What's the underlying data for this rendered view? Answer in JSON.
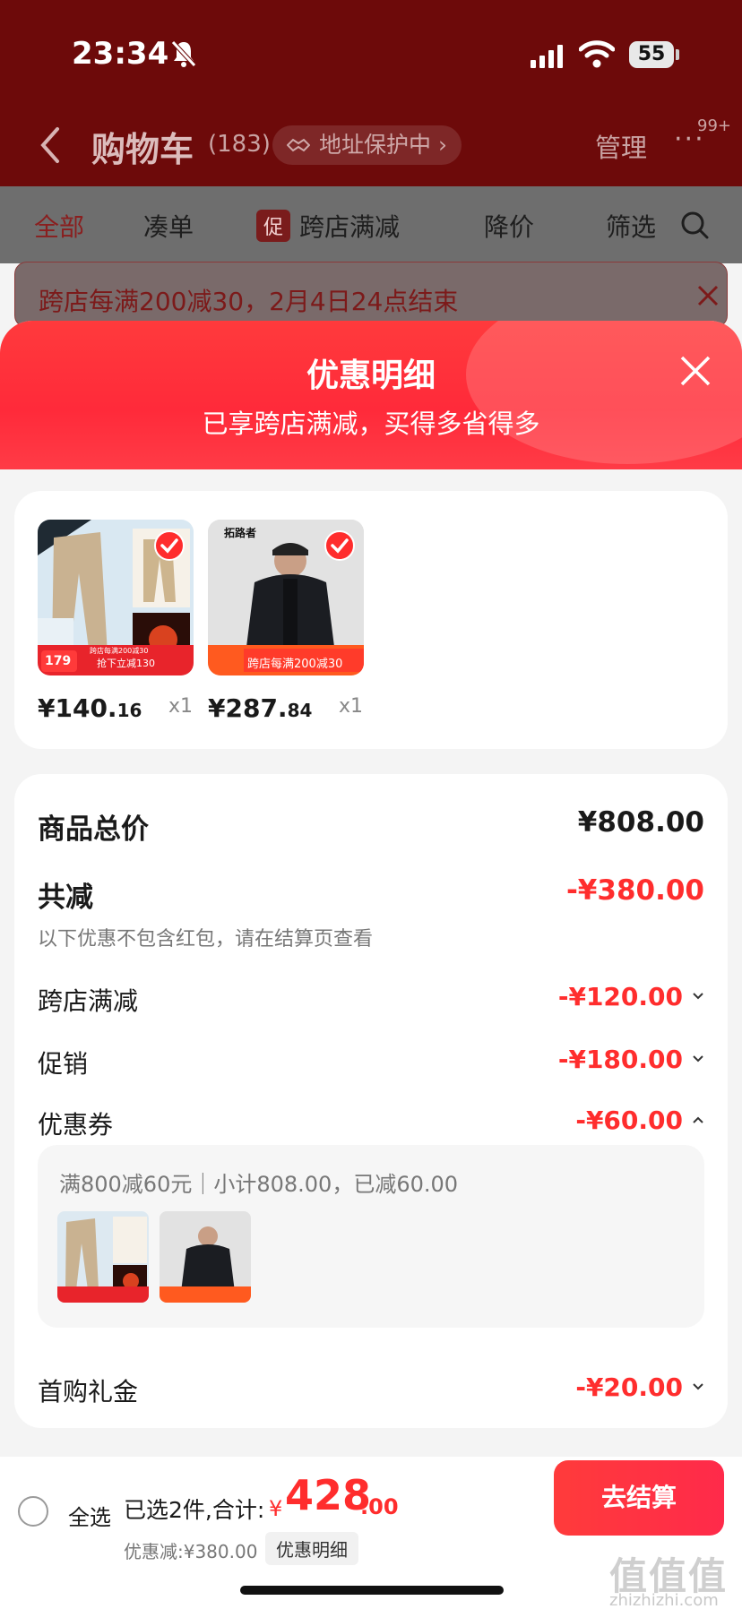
{
  "status_bar": {
    "time": "23:34",
    "battery": "55"
  },
  "nav": {
    "title": "购物车",
    "count": "(183)",
    "address_pill": "地址保护中",
    "manage": "管理",
    "more": "···",
    "badge": "99+"
  },
  "tabs": [
    {
      "label": "全部"
    },
    {
      "label": "凑单"
    },
    {
      "label": "跨店满减",
      "tag": "促"
    },
    {
      "label": "降价"
    },
    {
      "label": "筛选"
    }
  ],
  "promo_banner": {
    "text": "跨店每满200减30，2月4日24点结束"
  },
  "sheet": {
    "title": "优惠明细",
    "subtitle": "已享跨店满减，买得多省得多"
  },
  "products": [
    {
      "price_int": "¥140.",
      "price_dec": "16",
      "qty": "x1",
      "badge_price": "179",
      "badge_text": "抢下立减130",
      "badge_top": "跨店每满200减30"
    },
    {
      "price_int": "¥287.",
      "price_dec": "84",
      "qty": "x1",
      "badge_text": "跨店每满200减30",
      "brand": "拓路者"
    }
  ],
  "summary": {
    "total_label": "商品总价",
    "total_value": "¥808.00",
    "reduce_label": "共减",
    "reduce_value": "-¥380.00",
    "reduce_note": "以下优惠不包含红包，请在结算页查看",
    "rows": [
      {
        "label": "跨店满减",
        "value": "-¥120.00"
      },
      {
        "label": "促销",
        "value": "-¥180.00"
      },
      {
        "label": "优惠券",
        "value": "-¥60.00"
      },
      {
        "label": "首购礼金",
        "value": "-¥20.00"
      }
    ],
    "coupon_text": "满800减60元｜小计808.00，已减60.00"
  },
  "bottom": {
    "select_all": "全选",
    "selected": "已选2件,合计:",
    "yen": "¥",
    "total_int": "428",
    "total_dec": ".00",
    "discount": "优惠减:¥380.00",
    "detail_link": "优惠明细",
    "checkout": "去结算"
  },
  "watermark": {
    "logo": "值值值",
    "site": "zhizhizhi.com"
  },
  "colors": {
    "accent": "#ff2d2d",
    "header": "#6d0a0a"
  }
}
